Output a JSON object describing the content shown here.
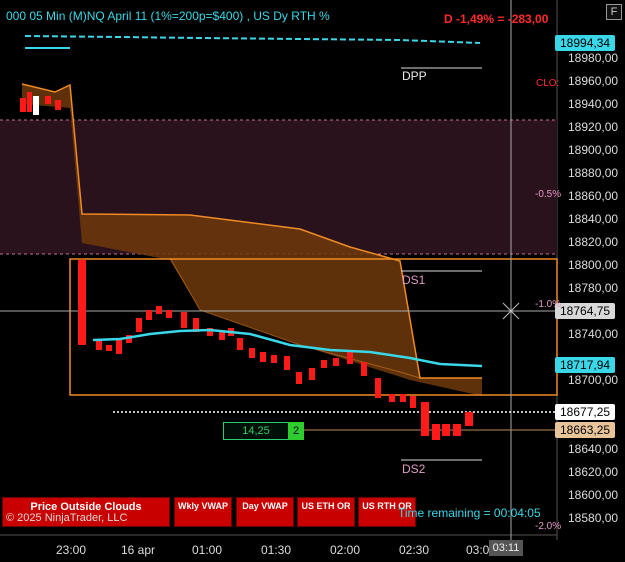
{
  "header": {
    "title": "000 05 Min (M)NQ  April 11 (1%=200p=$400) , US Dy RTH %",
    "pnl": "D -1,49% = -283,00",
    "format_button": "F"
  },
  "price_axis": {
    "labels": [
      "18980,00",
      "18960,00",
      "18940,00",
      "18920,00",
      "18900,00",
      "18880,00",
      "18860,00",
      "18840,00",
      "18820,00",
      "18800,00",
      "18780,00",
      "18740,00",
      "18700,00",
      "18660,00",
      "18640,00",
      "18620,00",
      "18600,00",
      "18580,00"
    ],
    "tags": {
      "top": "18994,34",
      "crosshair": "18764,75",
      "vwap": "18717,94",
      "last": "18677,25",
      "ref": "18663,25"
    }
  },
  "time_axis": {
    "labels": [
      "23:00",
      "16 apr",
      "01:00",
      "01:30",
      "02:00",
      "02:30",
      "03:0"
    ],
    "current": "03:11"
  },
  "chart_labels": {
    "dpp": "DPP",
    "ds1": "DS1",
    "ds2": "DS2",
    "clo": "CLO:",
    "pct1": "-0.5%",
    "pct2": "-1.0%",
    "pct3": "-2.0%"
  },
  "risk": {
    "value": "14,25",
    "qty": "2"
  },
  "buttons": [
    "Price Outside Clouds",
    "Wkly VWAP",
    "Day VWAP",
    "US ETH OR",
    "US RTH OR"
  ],
  "footer": {
    "copyright": "© 2025 NinjaTrader, LLC",
    "time_remaining": "Time remaining = 00:04:05"
  },
  "colors": {
    "up": "#ffffff",
    "down": "#ff1a1a",
    "vwap": "#3ad7e8",
    "cloud": "#f08a24"
  }
}
